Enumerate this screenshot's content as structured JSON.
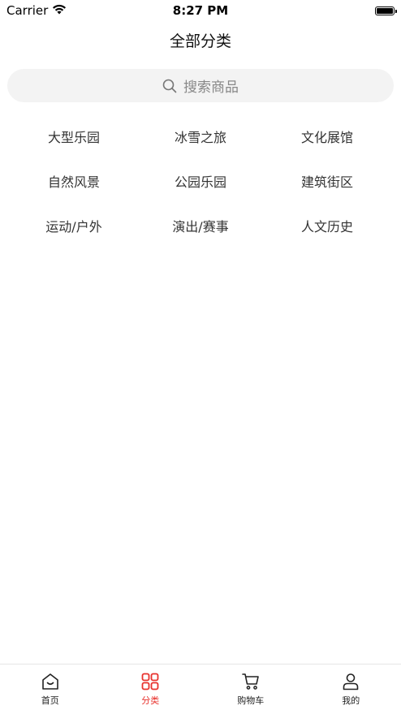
{
  "status_bar": {
    "carrier": "Carrier",
    "time": "8:27 PM"
  },
  "page": {
    "title": "全部分类"
  },
  "search": {
    "placeholder": "搜索商品"
  },
  "categories": [
    "大型乐园",
    "冰雪之旅",
    "文化展馆",
    "自然风景",
    "公园乐园",
    "建筑街区",
    "运动/户外",
    "演出/赛事",
    "人文历史"
  ],
  "tab_bar": {
    "active_color": "#e8322d",
    "tabs": [
      {
        "label": "首页",
        "icon": "home-icon",
        "active": false
      },
      {
        "label": "分类",
        "icon": "category-grid-icon",
        "active": true
      },
      {
        "label": "购物车",
        "icon": "cart-icon",
        "active": false
      },
      {
        "label": "我的",
        "icon": "user-icon",
        "active": false
      }
    ]
  }
}
